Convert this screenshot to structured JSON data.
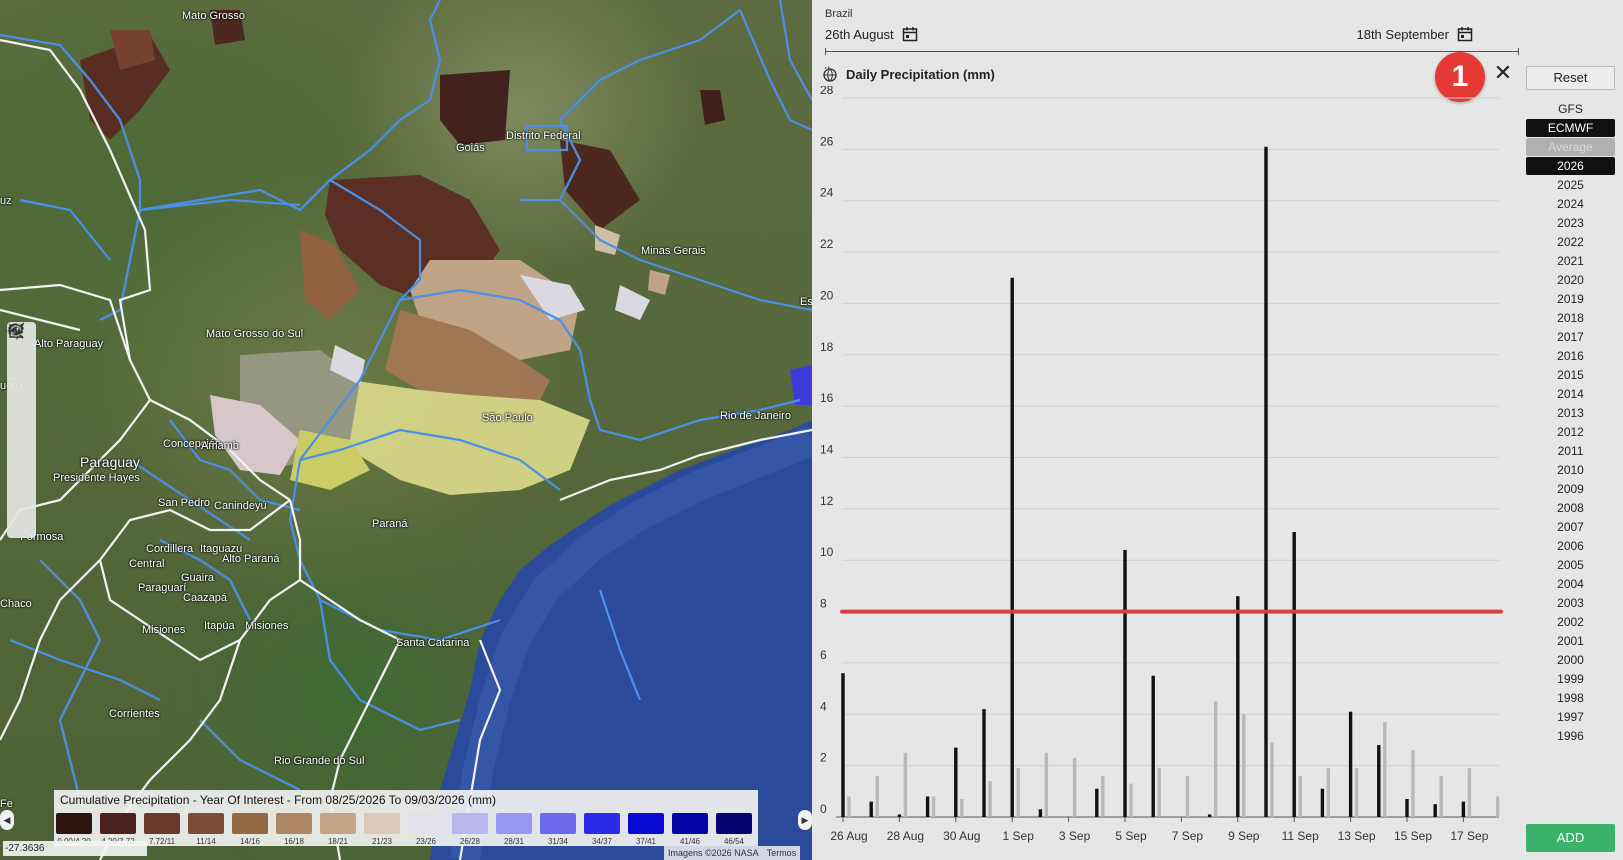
{
  "map": {
    "labels": [
      {
        "text": "Mato Grosso",
        "big": false
      },
      {
        "text": "Goiás",
        "big": false
      },
      {
        "text": "Distrito Federal",
        "big": false
      },
      {
        "text": "Minas Gerais",
        "big": false
      },
      {
        "text": "Mato Grosso do Sul",
        "big": false
      },
      {
        "text": "Alto Paraguay",
        "big": false
      },
      {
        "text": "Paraguay",
        "big": true
      },
      {
        "text": "Presidente Hayes",
        "big": false
      },
      {
        "text": "Concepción",
        "big": false
      },
      {
        "text": "Amamb",
        "big": false
      },
      {
        "text": "San Pedro",
        "big": false
      },
      {
        "text": "Canindeyú",
        "big": false
      },
      {
        "text": "Formosa",
        "big": false
      },
      {
        "text": "Cordillera",
        "big": false
      },
      {
        "text": "Itaguazu",
        "big": false
      },
      {
        "text": "Central",
        "big": false
      },
      {
        "text": "Guaira",
        "big": false
      },
      {
        "text": "Paraguarí",
        "big": false
      },
      {
        "text": "Caazapá",
        "big": false
      },
      {
        "text": "Alto Paraná",
        "big": false
      },
      {
        "text": "Chaco",
        "big": false
      },
      {
        "text": "Misiones",
        "big": false
      },
      {
        "text": "Itapúa",
        "big": false
      },
      {
        "text": "Misiones",
        "big": false
      },
      {
        "text": "São Paulo",
        "big": false
      },
      {
        "text": "Rio de Janeiro",
        "big": false
      },
      {
        "text": "Paraná",
        "big": false
      },
      {
        "text": "Santa Catarina",
        "big": false
      },
      {
        "text": "Corrientes",
        "big": false
      },
      {
        "text": "Rio Grande do Sul",
        "big": false
      },
      {
        "text": "uz",
        "big": false
      },
      {
        "text": "Es",
        "big": false
      },
      {
        "text": "Fe",
        "big": false
      },
      {
        "text": "uero",
        "big": false
      }
    ],
    "tools": [
      "layers-icon",
      "zoom-in-icon",
      "zoom-out-icon",
      "locate-icon",
      "search-icon",
      "measure-icon",
      "target-icon",
      "draw-icon"
    ],
    "legend": {
      "title": "Cumulative Precipitation - Year Of Interest - From 08/25/2026 To 09/03/2026 (mm)",
      "items": [
        {
          "label": "0.00/4.20",
          "color": "#2e1512"
        },
        {
          "label": "4.20/7.72",
          "color": "#4b231c"
        },
        {
          "label": "7.72/11",
          "color": "#6b3a2c"
        },
        {
          "label": "11/14",
          "color": "#7d4c36"
        },
        {
          "label": "14/16",
          "color": "#956844"
        },
        {
          "label": "16/18",
          "color": "#ad8764"
        },
        {
          "label": "18/21",
          "color": "#c4a387"
        },
        {
          "label": "21/23",
          "color": "#dbc8b6"
        },
        {
          "label": "23/26",
          "color": "#e3e1ec"
        },
        {
          "label": "26/28",
          "color": "#b9b6ee"
        },
        {
          "label": "28/31",
          "color": "#9896ee"
        },
        {
          "label": "31/34",
          "color": "#6a68ec"
        },
        {
          "label": "34/37",
          "color": "#2b2bea"
        },
        {
          "label": "37/41",
          "color": "#0a0ad6"
        },
        {
          "label": "41/46",
          "color": "#0606a8"
        },
        {
          "label": "46/54",
          "color": "#040470"
        }
      ]
    },
    "coord": "-27.3636",
    "attribution": [
      "Imagens ©2026 NASA",
      "Termos"
    ]
  },
  "panel": {
    "region": "Brazil",
    "start_date": "26th August",
    "end_date": "18th September",
    "chart_title": "Daily Precipitation (mm)",
    "badge": "1",
    "close_symbol": "✕",
    "reset_label": "Reset",
    "add_label": "ADD",
    "models": [
      {
        "label": "GFS",
        "state": "normal"
      },
      {
        "label": "ECMWF",
        "state": "selected"
      },
      {
        "label": "Average",
        "state": "dim"
      }
    ],
    "years": [
      "2026",
      "2025",
      "2024",
      "2023",
      "2022",
      "2021",
      "2020",
      "2019",
      "2018",
      "2017",
      "2016",
      "2015",
      "2014",
      "2013",
      "2012",
      "2011",
      "2010",
      "2009",
      "2008",
      "2007",
      "2006",
      "2005",
      "2004",
      "2003",
      "2002",
      "2001",
      "2000",
      "1999",
      "1998",
      "1997",
      "1996"
    ],
    "selected_year": "2026"
  },
  "chart_data": {
    "type": "bar",
    "title": "Daily Precipitation (mm)",
    "ylim": [
      0,
      28
    ],
    "yticks": [
      0,
      2,
      4,
      6,
      8,
      10,
      12,
      14,
      16,
      18,
      20,
      22,
      24,
      26,
      28
    ],
    "x_tick_labels": [
      "26 Aug",
      "28 Aug",
      "30 Aug",
      "1 Sep",
      "3 Sep",
      "5 Sep",
      "7 Sep",
      "9 Sep",
      "11 Sep",
      "13 Sep",
      "15 Sep",
      "17 Sep"
    ],
    "threshold": 8,
    "threshold_color": "#d94040",
    "series": [
      {
        "color": "#111111",
        "values": [
          5.6,
          0.6,
          0.1,
          0.8,
          2.7,
          4.2,
          21.0,
          0.3,
          0,
          1.1,
          10.4,
          5.5,
          0,
          0.1,
          8.6,
          26.1,
          11.1,
          1.1,
          4.1,
          2.8,
          0.7,
          0.5,
          0.6,
          0
        ]
      },
      {
        "color": "#b8b8b8",
        "values": [
          0.8,
          1.6,
          2.5,
          0.8,
          0.7,
          1.4,
          1.9,
          2.5,
          2.3,
          1.6,
          1.3,
          1.9,
          1.6,
          4.5,
          4.0,
          2.9,
          1.6,
          1.9,
          1.9,
          3.7,
          2.6,
          1.6,
          1.9,
          0.8
        ]
      }
    ]
  }
}
